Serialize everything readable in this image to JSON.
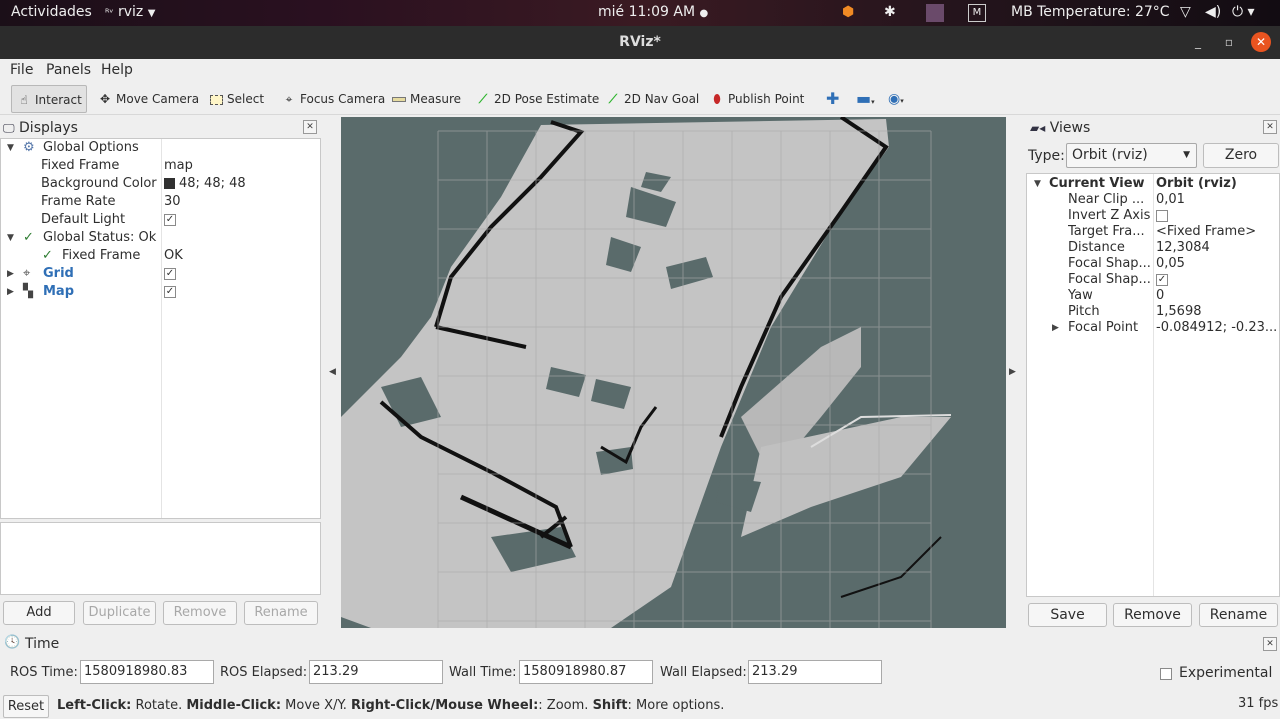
{
  "topbar": {
    "activities": "Actividades",
    "app_name": "rviz",
    "clock": "mié 11:09 AM",
    "temperature": "MB Temperature: 27°C"
  },
  "window": {
    "title": "RViz*"
  },
  "menu": {
    "file": "File",
    "panels": "Panels",
    "help": "Help"
  },
  "toolbar": {
    "interact": "Interact",
    "move_camera": "Move Camera",
    "select": "Select",
    "focus_camera": "Focus Camera",
    "measure": "Measure",
    "pose_estimate": "2D Pose Estimate",
    "nav_goal": "2D Nav Goal",
    "publish_point": "Publish Point"
  },
  "displays": {
    "title": "Displays",
    "global_options": "Global Options",
    "fixed_frame_label": "Fixed Frame",
    "fixed_frame_value": "map",
    "bg_color_label": "Background Color",
    "bg_color_value": "48; 48; 48",
    "bg_color_hex": "#303030",
    "frame_rate_label": "Frame Rate",
    "frame_rate_value": "30",
    "default_light_label": "Default Light",
    "global_status": "Global Status: Ok",
    "status_fixed_frame_label": "Fixed Frame",
    "status_fixed_frame_value": "OK",
    "grid": "Grid",
    "map": "Map",
    "buttons": {
      "add": "Add",
      "duplicate": "Duplicate",
      "remove": "Remove",
      "rename": "Rename"
    }
  },
  "views": {
    "title": "Views",
    "type_label": "Type:",
    "type_value": "Orbit (rviz)",
    "zero": "Zero",
    "rows": {
      "current_view": "Current View",
      "current_view_val": "Orbit (rviz)",
      "near_clip": "Near Clip ...",
      "near_clip_val": "0,01",
      "invert_z": "Invert Z Axis",
      "target_frame": "Target Fra...",
      "target_frame_val": "<Fixed Frame>",
      "distance": "Distance",
      "distance_val": "12,3084",
      "focal_shape1": "Focal Shap...",
      "focal_shape1_val": "0,05",
      "focal_shape2": "Focal Shap...",
      "yaw": "Yaw",
      "yaw_val": "0",
      "pitch": "Pitch",
      "pitch_val": "1,5698",
      "focal_point": "Focal Point",
      "focal_point_val": "-0.084912; -0.23..."
    },
    "buttons": {
      "save": "Save",
      "remove": "Remove",
      "rename": "Rename"
    }
  },
  "time": {
    "title": "Time",
    "ros_time_label": "ROS Time:",
    "ros_time": "1580918980.83",
    "ros_elapsed_label": "ROS Elapsed:",
    "ros_elapsed": "213.29",
    "wall_time_label": "Wall Time:",
    "wall_time": "1580918980.87",
    "wall_elapsed_label": "Wall Elapsed:",
    "wall_elapsed": "213.29",
    "experimental": "Experimental"
  },
  "status": {
    "reset": "Reset",
    "left_click": "Left-Click:",
    "left_click_text": " Rotate. ",
    "middle_click": "Middle-Click:",
    "middle_click_text": " Move X/Y. ",
    "right_click": "Right-Click/Mouse Wheel:",
    "right_click_text": ": Zoom. ",
    "shift": "Shift",
    "shift_text": ": More options.",
    "fps": "31 fps"
  },
  "colors": {
    "accent_close": "#e95420",
    "map_unknown": "#5a6b6b",
    "map_free": "#c4c4c4"
  }
}
